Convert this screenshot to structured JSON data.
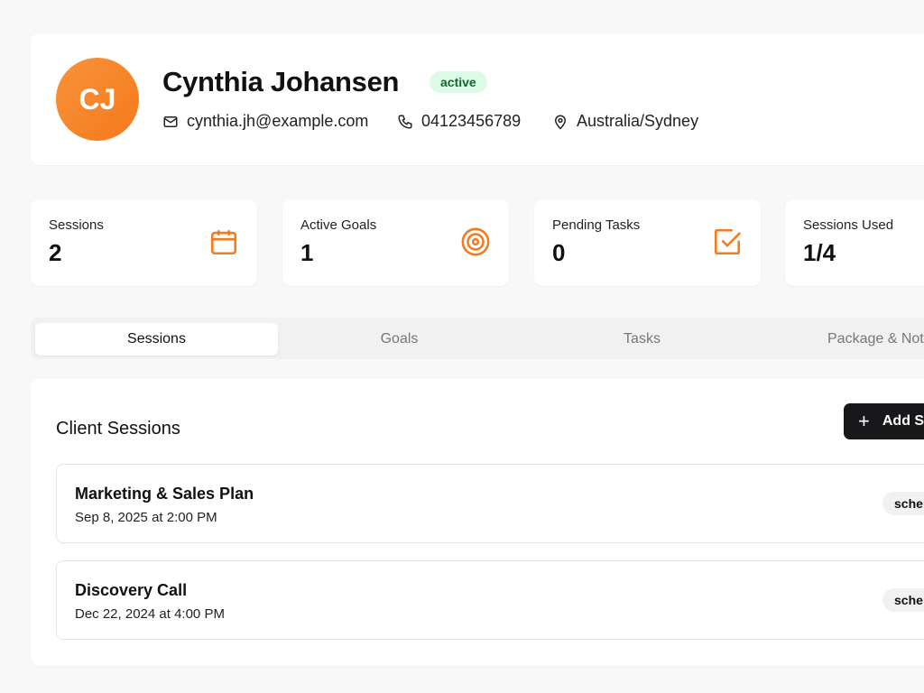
{
  "client": {
    "initials": "CJ",
    "name": "Cynthia Johansen",
    "status": "active",
    "email": "cynthia.jh@example.com",
    "phone": "04123456789",
    "timezone": "Australia/Sydney"
  },
  "stats": [
    {
      "label": "Sessions",
      "value": "2",
      "icon": "calendar-icon"
    },
    {
      "label": "Active Goals",
      "value": "1",
      "icon": "target-icon"
    },
    {
      "label": "Pending Tasks",
      "value": "0",
      "icon": "checkbox-icon"
    },
    {
      "label": "Sessions Used",
      "value": "1/4"
    }
  ],
  "tabs": [
    "Sessions",
    "Goals",
    "Tasks",
    "Package & Not"
  ],
  "sessions": {
    "title": "Client Sessions",
    "add_label": "Add S",
    "items": [
      {
        "title": "Marketing & Sales Plan",
        "date": "Sep 8, 2025 at 2:00 PM",
        "status": "sche"
      },
      {
        "title": "Discovery Call",
        "date": "Dec 22, 2024 at 4:00 PM",
        "status": "sche"
      }
    ]
  },
  "colors": {
    "accent": "#f47a1c",
    "badge_bg": "#dcfce7",
    "badge_text": "#166534"
  }
}
